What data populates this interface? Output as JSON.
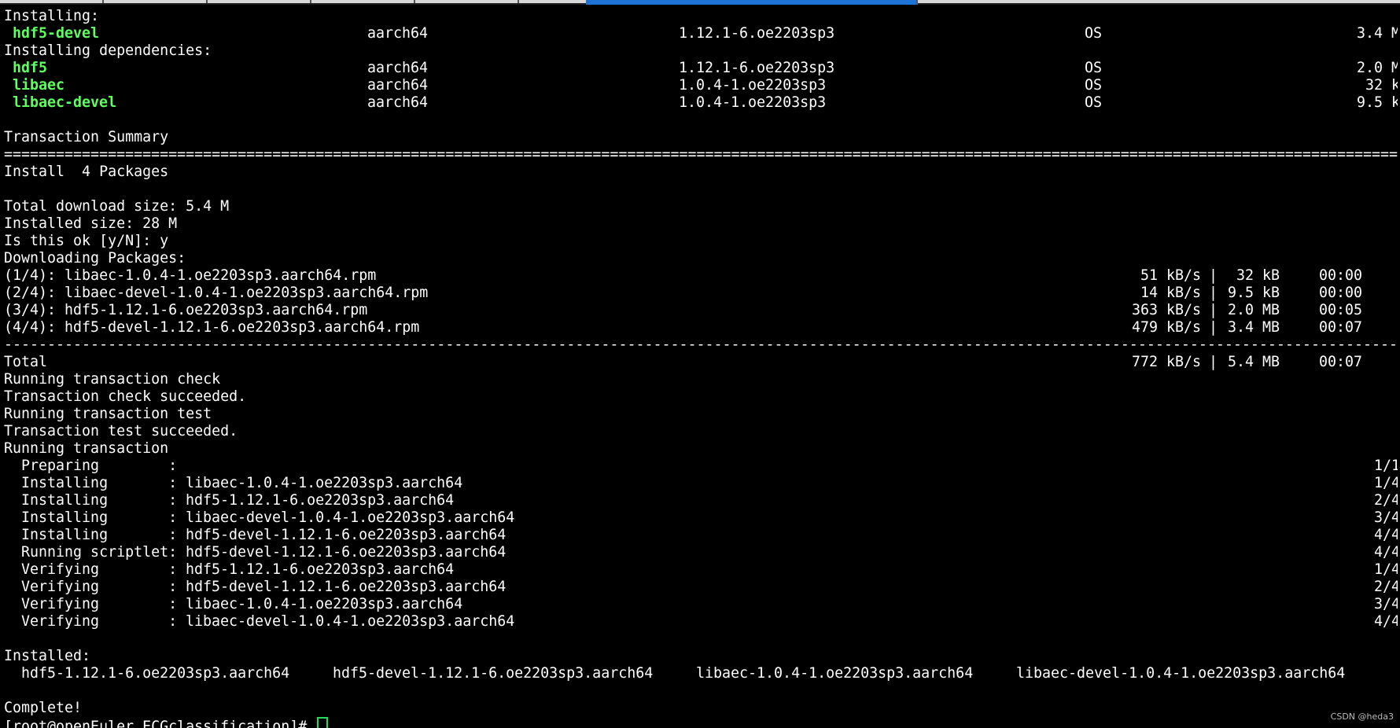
{
  "tabs": [
    {
      "label": ""
    },
    {
      "label": ""
    },
    {
      "label": ""
    },
    {
      "label": ""
    },
    {
      "label": ""
    },
    {
      "label": "",
      "active": true
    },
    {
      "label": ""
    },
    {
      "label": ""
    }
  ],
  "colors": {
    "background": "#000000",
    "text": "#ffffff",
    "package_highlight": "#5fff5f",
    "cursor": "#22dd55",
    "active_tab": "#1e73d6"
  },
  "terminal": {
    "installing_header": "Installing:",
    "deps_header": "Installing dependencies:",
    "packages": [
      {
        "name": "hdf5-devel",
        "arch": "aarch64",
        "version": "1.12.1-6.oe2203sp3",
        "repo": "OS",
        "size": "3.4 M"
      },
      {
        "name": "hdf5",
        "arch": "aarch64",
        "version": "1.12.1-6.oe2203sp3",
        "repo": "OS",
        "size": "2.0 M"
      },
      {
        "name": "libaec",
        "arch": "aarch64",
        "version": "1.0.4-1.oe2203sp3",
        "repo": "OS",
        "size": "32 k"
      },
      {
        "name": "libaec-devel",
        "arch": "aarch64",
        "version": "1.0.4-1.oe2203sp3",
        "repo": "OS",
        "size": "9.5 k"
      }
    ],
    "transaction_summary": "Transaction Summary",
    "equals_separator": "===================================================================================================================================================================================================",
    "install_count": "Install  4 Packages",
    "total_download_size": "Total download size: 5.4 M",
    "installed_size": "Installed size: 28 M",
    "prompt_confirm": "Is this ok [y/N]: y",
    "downloading_header": "Downloading Packages:",
    "downloads": [
      {
        "name": "(1/4): libaec-1.0.4-1.oe2203sp3.aarch64.rpm",
        "speed": "51 kB/s",
        "size": "32 kB",
        "time": "00:00"
      },
      {
        "name": "(2/4): libaec-devel-1.0.4-1.oe2203sp3.aarch64.rpm",
        "speed": "14 kB/s",
        "size": "9.5 kB",
        "time": "00:00"
      },
      {
        "name": "(3/4): hdf5-1.12.1-6.oe2203sp3.aarch64.rpm",
        "speed": "363 kB/s",
        "size": "2.0 MB",
        "time": "00:05"
      },
      {
        "name": "(4/4): hdf5-devel-1.12.1-6.oe2203sp3.aarch64.rpm",
        "speed": "479 kB/s",
        "size": "3.4 MB",
        "time": "00:07"
      }
    ],
    "dash_separator": "---------------------------------------------------------------------------------------------------------------------------------------------------------------------------------------------------",
    "total": {
      "label": "Total",
      "speed": "772 kB/s",
      "size": "5.4 MB",
      "time": "00:07"
    },
    "pipe": "|",
    "status_lines": [
      "Running transaction check",
      "Transaction check succeeded.",
      "Running transaction test",
      "Transaction test succeeded.",
      "Running transaction"
    ],
    "steps": [
      {
        "action": "  Preparing        :",
        "target": "",
        "progress": "1/1"
      },
      {
        "action": "  Installing       :",
        "target": "libaec-1.0.4-1.oe2203sp3.aarch64",
        "progress": "1/4"
      },
      {
        "action": "  Installing       :",
        "target": "hdf5-1.12.1-6.oe2203sp3.aarch64",
        "progress": "2/4"
      },
      {
        "action": "  Installing       :",
        "target": "libaec-devel-1.0.4-1.oe2203sp3.aarch64",
        "progress": "3/4"
      },
      {
        "action": "  Installing       :",
        "target": "hdf5-devel-1.12.1-6.oe2203sp3.aarch64",
        "progress": "4/4"
      },
      {
        "action": "  Running scriptlet:",
        "target": "hdf5-devel-1.12.1-6.oe2203sp3.aarch64",
        "progress": "4/4"
      },
      {
        "action": "  Verifying        :",
        "target": "hdf5-1.12.1-6.oe2203sp3.aarch64",
        "progress": "1/4"
      },
      {
        "action": "  Verifying        :",
        "target": "hdf5-devel-1.12.1-6.oe2203sp3.aarch64",
        "progress": "2/4"
      },
      {
        "action": "  Verifying        :",
        "target": "libaec-1.0.4-1.oe2203sp3.aarch64",
        "progress": "3/4"
      },
      {
        "action": "  Verifying        :",
        "target": "libaec-devel-1.0.4-1.oe2203sp3.aarch64",
        "progress": "4/4"
      }
    ],
    "installed_header": "Installed:",
    "installed_items": [
      "hdf5-1.12.1-6.oe2203sp3.aarch64",
      "hdf5-devel-1.12.1-6.oe2203sp3.aarch64",
      "libaec-1.0.4-1.oe2203sp3.aarch64",
      "libaec-devel-1.0.4-1.oe2203sp3.aarch64"
    ],
    "complete": "Complete!",
    "prompt": "[root@openEuler ECGclassification]# "
  },
  "watermark": "CSDN @heda3"
}
